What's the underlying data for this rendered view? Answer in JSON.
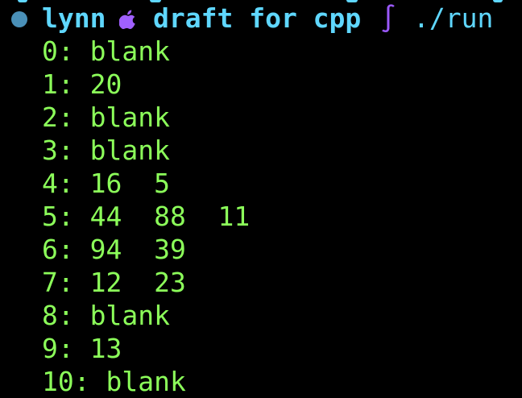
{
  "prompt": {
    "user": "lynn",
    "branch_label": "draft for cpp",
    "command": "./run",
    "icons": {
      "status": "status-dot-icon",
      "os": "apple-icon",
      "prompt_symbol": "integral-icon"
    },
    "integral_symbol": "∫",
    "colors": {
      "prompt": "#5fd7ff",
      "integral": "#9b59ff",
      "apple": "#a060ff",
      "dot": "#4a90b8"
    }
  },
  "output": {
    "color": "#8cff5a",
    "lines": [
      "0: blank",
      "1: 20",
      "2: blank",
      "3: blank",
      "4: 16  5",
      "5: 44  88  11",
      "6: 94  39",
      "7: 12  23",
      "8: blank",
      "9: 13",
      "10: blank"
    ]
  }
}
